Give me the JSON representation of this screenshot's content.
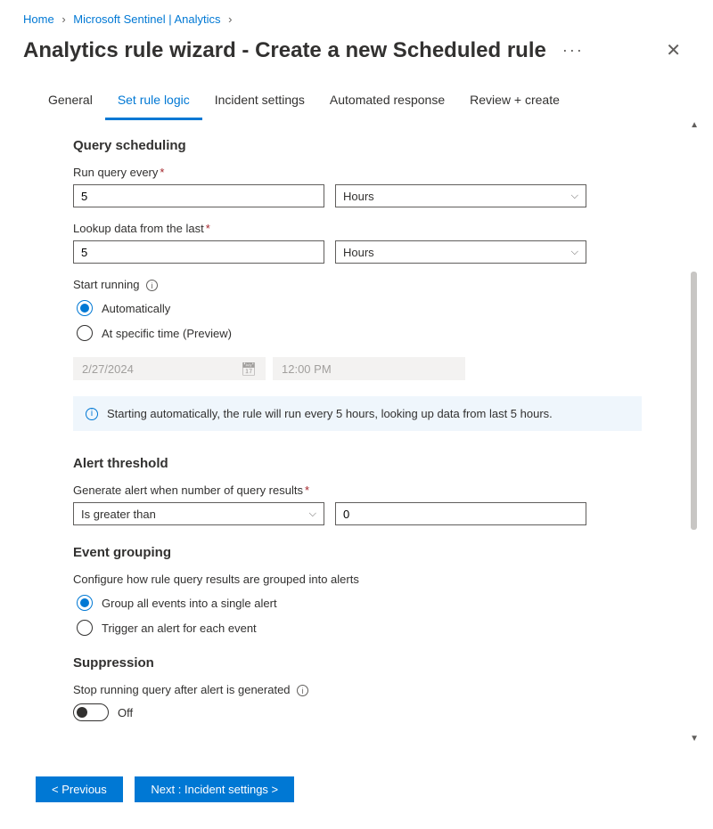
{
  "breadcrumb": {
    "home": "Home",
    "sentinel": "Microsoft Sentinel | Analytics"
  },
  "header": {
    "title": "Analytics rule wizard - Create a new Scheduled rule"
  },
  "tabs": {
    "general": "General",
    "setrule": "Set rule logic",
    "incident": "Incident settings",
    "automated": "Automated response",
    "review": "Review + create"
  },
  "scheduling": {
    "title": "Query scheduling",
    "runEveryLabel": "Run query every",
    "runEveryValue": "5",
    "runEveryUnit": "Hours",
    "lookupLabel": "Lookup data from the last",
    "lookupValue": "5",
    "lookupUnit": "Hours",
    "startLabel": "Start running",
    "optAuto": "Automatically",
    "optSpecific": "At specific time (Preview)",
    "date": "2/27/2024",
    "time": "12:00 PM",
    "infoText": "Starting automatically, the rule will run every 5 hours, looking up data from last 5 hours."
  },
  "threshold": {
    "title": "Alert threshold",
    "label": "Generate alert when number of query results",
    "operator": "Is greater than",
    "value": "0"
  },
  "grouping": {
    "title": "Event grouping",
    "label": "Configure how rule query results are grouped into alerts",
    "optSingle": "Group all events into a single alert",
    "optEach": "Trigger an alert for each event"
  },
  "suppression": {
    "title": "Suppression",
    "label": "Stop running query after alert is generated",
    "state": "Off"
  },
  "footer": {
    "prev": "< Previous",
    "next": "Next : Incident settings >"
  }
}
